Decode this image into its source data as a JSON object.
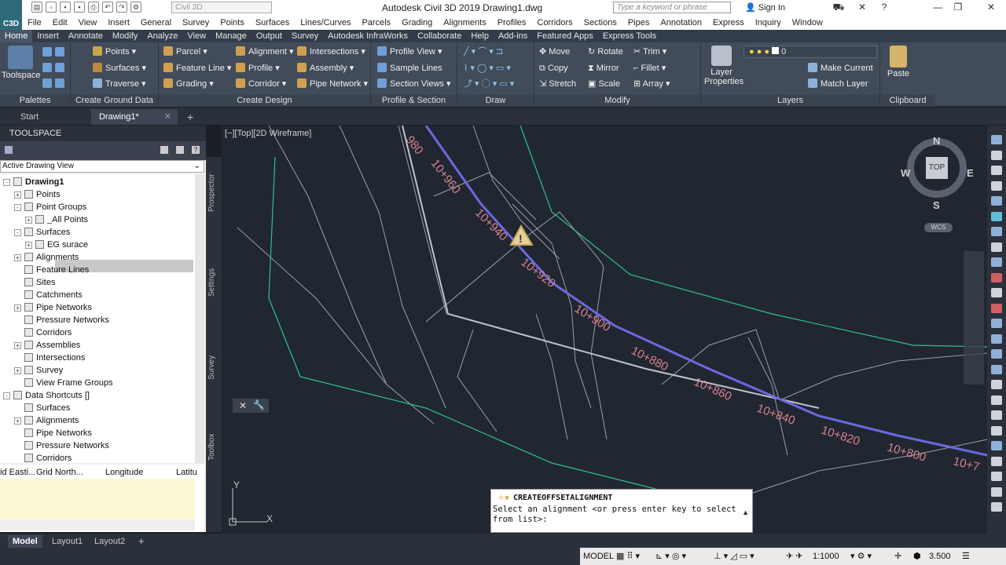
{
  "app": {
    "title": "Autodesk Civil 3D 2019    Drawing1.dwg",
    "workspace": "Civil 3D",
    "search_placeholder": "Type a keyword or phrase",
    "sign_in": "Sign In",
    "logo": "C3D"
  },
  "menu": [
    "File",
    "Edit",
    "View",
    "Insert",
    "General",
    "Survey",
    "Points",
    "Surfaces",
    "Lines/Curves",
    "Parcels",
    "Grading",
    "Alignments",
    "Profiles",
    "Corridors",
    "Sections",
    "Pipes",
    "Annotation",
    "Express",
    "Inquiry",
    "Window"
  ],
  "ribbon_tabs": [
    "Home",
    "Insert",
    "Annotate",
    "Modify",
    "Analyze",
    "View",
    "Manage",
    "Output",
    "Survey",
    "Autodesk InfraWorks",
    "Collaborate",
    "Help",
    "Add-ins",
    "Featured Apps",
    "Express Tools"
  ],
  "ribbon": {
    "toolspace": "Toolspace",
    "palettes": "Palettes",
    "ground": {
      "title": "Create Ground Data",
      "points": "Points",
      "surfaces": "Surfaces",
      "traverse": "Traverse"
    },
    "design": {
      "title": "Create Design",
      "parcel": "Parcel",
      "feature_line": "Feature Line",
      "grading": "Grading",
      "alignment": "Alignment",
      "profile": "Profile",
      "corridor": "Corridor",
      "intersections": "Intersections",
      "assembly": "Assembly",
      "pipe_network": "Pipe Network"
    },
    "profile_section": {
      "title": "Profile & Section Views",
      "profile_view": "Profile View",
      "sample_lines": "Sample Lines",
      "section_views": "Section Views"
    },
    "draw": {
      "title": "Draw"
    },
    "modify": {
      "title": "Modify",
      "move": "Move",
      "copy": "Copy",
      "stretch": "Stretch",
      "rotate": "Rotate",
      "mirror": "Mirror",
      "scale": "Scale",
      "trim": "Trim",
      "fillet": "Fillet",
      "array": "Array"
    },
    "layers": {
      "title": "Layers",
      "layer_properties": "Layer Properties",
      "current_layer": "0",
      "make_current": "Make Current",
      "match_layer": "Match Layer"
    },
    "clipboard": {
      "title": "Clipboard",
      "paste": "Paste"
    }
  },
  "file_tabs": [
    "Start",
    "Drawing1*"
  ],
  "toolspace": {
    "header": "TOOLSPACE",
    "view": "Active Drawing View",
    "vertical_tabs": [
      "Prospector",
      "Settings",
      "Survey",
      "Toolbox"
    ],
    "tree": [
      {
        "label": "Drawing1",
        "level": 0,
        "exp": "-",
        "bold": true
      },
      {
        "label": "Points",
        "level": 1,
        "exp": "+"
      },
      {
        "label": "Point Groups",
        "level": 1,
        "exp": "-"
      },
      {
        "label": "_All Points",
        "level": 2,
        "exp": "+"
      },
      {
        "label": "Surfaces",
        "level": 1,
        "exp": "-"
      },
      {
        "label": "EG surace",
        "level": 2,
        "exp": "+"
      },
      {
        "label": "Alignments",
        "level": 1,
        "exp": "+"
      },
      {
        "label": "Feature Lines",
        "level": 1,
        "exp": ""
      },
      {
        "label": "Sites",
        "level": 1,
        "exp": ""
      },
      {
        "label": "Catchments",
        "level": 1,
        "exp": ""
      },
      {
        "label": "Pipe Networks",
        "level": 1,
        "exp": "+"
      },
      {
        "label": "Pressure Networks",
        "level": 1,
        "exp": ""
      },
      {
        "label": "Corridors",
        "level": 1,
        "exp": ""
      },
      {
        "label": "Assemblies",
        "level": 1,
        "exp": "+"
      },
      {
        "label": "Intersections",
        "level": 1,
        "exp": ""
      },
      {
        "label": "Survey",
        "level": 1,
        "exp": "+"
      },
      {
        "label": "View Frame Groups",
        "level": 1,
        "exp": ""
      },
      {
        "label": "Data Shortcuts []",
        "level": 0,
        "exp": "-"
      },
      {
        "label": "Surfaces",
        "level": 1,
        "exp": ""
      },
      {
        "label": "Alignments",
        "level": 1,
        "exp": "+"
      },
      {
        "label": "Pipe Networks",
        "level": 1,
        "exp": ""
      },
      {
        "label": "Pressure Networks",
        "level": 1,
        "exp": ""
      },
      {
        "label": "Corridors",
        "level": 1,
        "exp": ""
      }
    ],
    "grid_headers": [
      "id Easti...",
      "Grid North...",
      "Longitude",
      "Latitu"
    ]
  },
  "viewport": {
    "label": "[−][Top][2D Wireframe]",
    "compass": {
      "n": "N",
      "s": "S",
      "e": "E",
      "w": "W",
      "top": "TOP",
      "wcs": "WCS"
    },
    "stations": [
      "980",
      "10+960",
      "10+940",
      "10+920",
      "10+900",
      "10+880",
      "10+860",
      "10+840",
      "10+820",
      "10+800",
      "10+7"
    ],
    "ucs": {
      "x": "X",
      "y": "Y"
    }
  },
  "command": {
    "name": "CREATEOFFSETALIGNMENT",
    "prompt": "Select an alignment <or press enter key to select from list>:"
  },
  "layout_tabs": [
    "Model",
    "Layout1",
    "Layout2"
  ],
  "status": {
    "model": "MODEL",
    "scale": "1:1000",
    "value": "3.500"
  },
  "colors": {
    "alignment": "#6a6adf",
    "station_text": "#d8828e",
    "contour_green": "#2fbf8f",
    "bg": "#212731"
  }
}
